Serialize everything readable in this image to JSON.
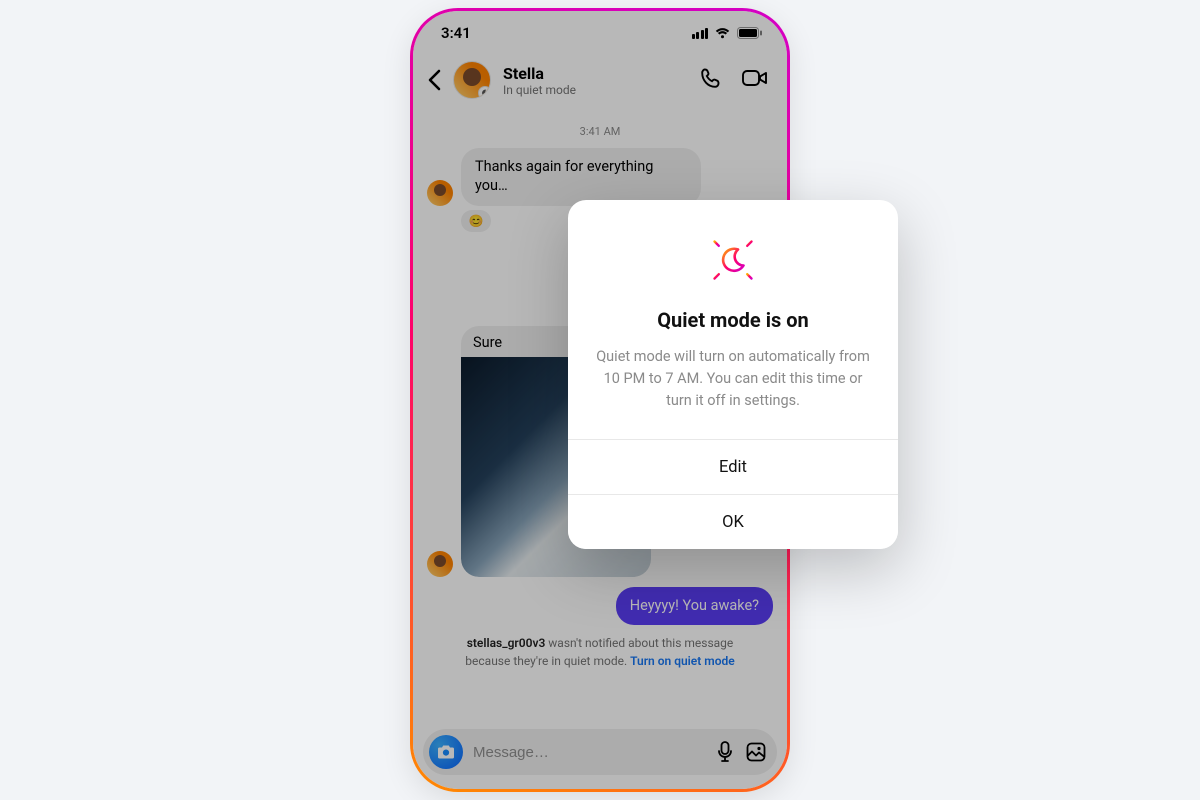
{
  "status": {
    "time": "3:41"
  },
  "chat": {
    "name": "Stella",
    "subtitle": "In quiet mode",
    "timestamp": "3:41 AM",
    "msg1": "Thanks again for everything you…",
    "msg2_prefix": "Sure",
    "my_msg": "Heyyyy! You awake?",
    "notice_user": "stellas_gr00v3",
    "notice_text": " wasn't notified about this message because they're in quiet mode. ",
    "notice_link": "Turn on quiet mode",
    "placeholder": "Message…"
  },
  "modal": {
    "title": "Quiet mode is on",
    "desc": "Quiet mode will turn on automatically from 10 PM to 7 AM. You can edit this time or turn it off in settings.",
    "edit": "Edit",
    "ok": "OK"
  }
}
